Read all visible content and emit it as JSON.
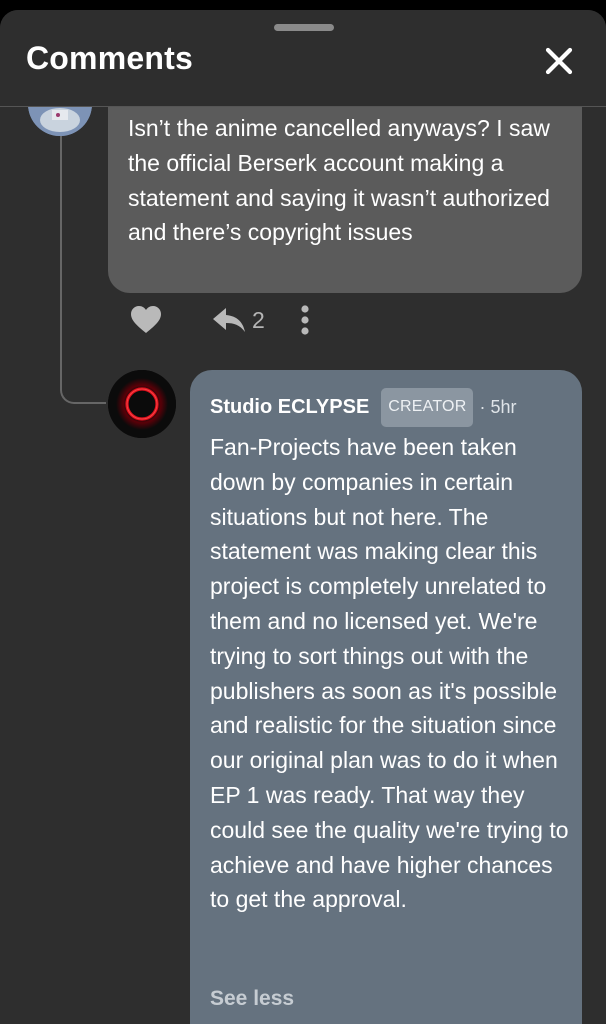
{
  "header": {
    "title": "Comments"
  },
  "icons": {
    "close": "close-icon",
    "like": "heart-icon",
    "reply": "reply-icon",
    "more": "more-vertical-icon",
    "creator_avatar": "red-ring-logo"
  },
  "comment_parent": {
    "body": "Isn’t the anime cancelled anyways? I saw the official Berserk account making a statement and saying it wasn’t authorized and there’s copyright issues",
    "reply_count": "2"
  },
  "comment_reply": {
    "author": "Studio ECLYPSE",
    "badge": "CREATOR",
    "time": "· 5hr",
    "body": "Fan-Projects have been taken down by companies in certain situations but not here. The statement was making clear this project is completely unrelated to them and no licensed yet. We're trying to sort things out with the publishers as soon as it's possible and realistic for the situation since our original plan was to do it when EP 1 was ready. That way they could see the quality we're trying to achieve and have higher chances to get the approval.",
    "see_less_label": "See less"
  },
  "colors": {
    "sheet_bg": "#2e2e2e",
    "parent_bubble": "#5b5b5b",
    "creator_bubble": "#65727f",
    "creator_ring": "#e0101c"
  }
}
